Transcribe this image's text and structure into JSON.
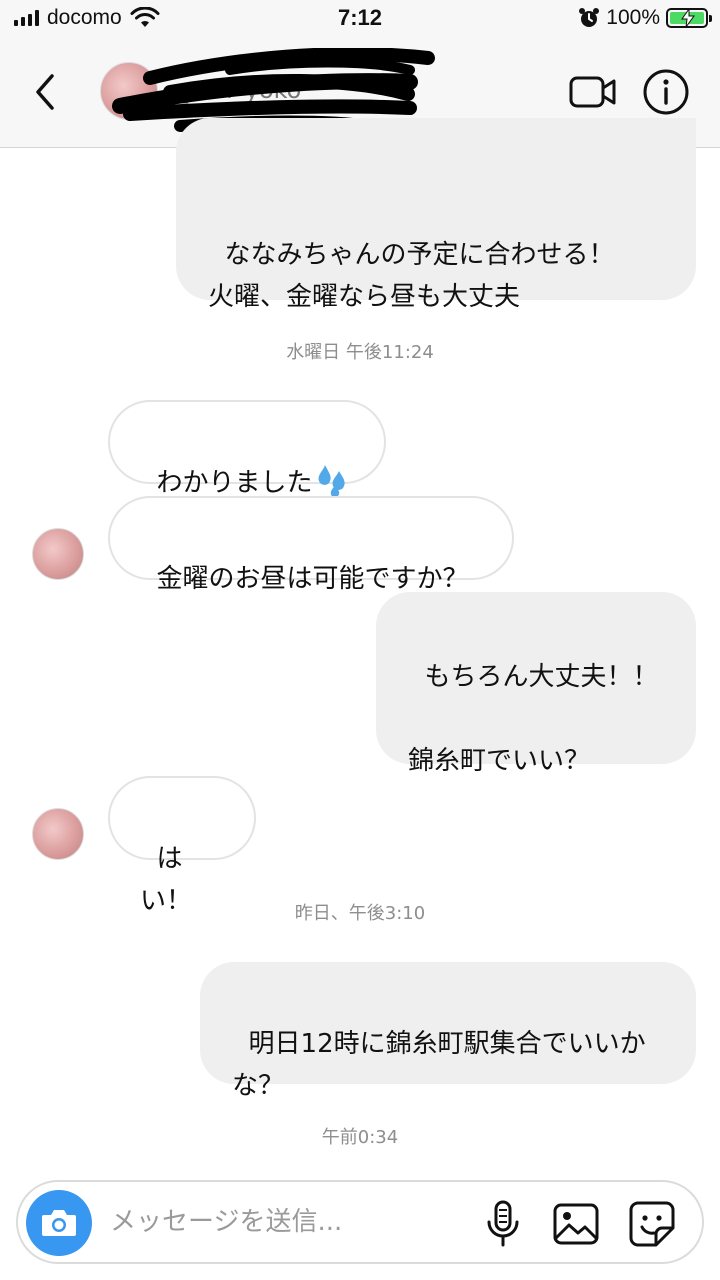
{
  "status_bar": {
    "carrier": "docomo",
    "time": "7:12",
    "battery_percent": "100%",
    "icons": [
      "signal-icon",
      "wifi-icon",
      "alarm-icon",
      "battery-charging-icon"
    ]
  },
  "header": {
    "contact_name": "_ami_yoko",
    "icons": [
      "back-chevron-icon",
      "video-camera-icon",
      "info-icon"
    ]
  },
  "messages": [
    {
      "type": "sent",
      "text": "ななみちゃんの予定に合わせる！\n火曜、金曜なら昼も大丈夫"
    },
    {
      "type": "timestamp",
      "text": "水曜日 午後11:24"
    },
    {
      "type": "received",
      "text": "わかりました"
    },
    {
      "type": "received",
      "text": "金曜のお昼は可能ですか？"
    },
    {
      "type": "sent",
      "text": "もちろん大丈夫！！\n\n錦糸町でいい？"
    },
    {
      "type": "received",
      "text": "はい！"
    },
    {
      "type": "timestamp",
      "text": "昨日、午後3:10"
    },
    {
      "type": "sent",
      "text": "明日12時に錦糸町駅集合でいいか\nな？"
    },
    {
      "type": "timestamp",
      "text": "午前0:34"
    }
  ],
  "composer": {
    "placeholder": "メッセージを送信...",
    "value": "",
    "icons": [
      "camera-icon",
      "microphone-icon",
      "gallery-icon",
      "sticker-icon"
    ]
  },
  "colors": {
    "accent": "#3897f0",
    "sent_bubble": "#efefef",
    "received_border": "#e3e3e3",
    "timestamp": "#8e8e8e",
    "battery_fill": "#4cd964"
  }
}
